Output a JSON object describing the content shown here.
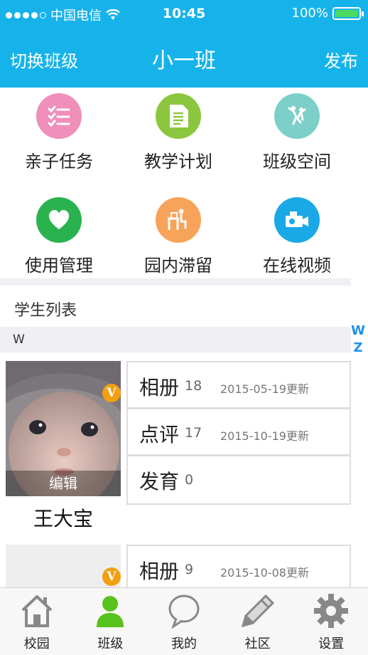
{
  "status": {
    "carrier": "中国电信",
    "time": "10:45",
    "battery": "100%"
  },
  "nav": {
    "left_label": "切换班级",
    "title": "小一班",
    "right_label": "发布"
  },
  "grid": [
    {
      "label": "亲子任务",
      "color": "#f08fb9",
      "icon": "checklist-icon"
    },
    {
      "label": "教学计划",
      "color": "#8cc63e",
      "icon": "document-icon"
    },
    {
      "label": "班级空间",
      "color": "#7dcfc9",
      "icon": "dancer-icon"
    },
    {
      "label": "使用管理",
      "color": "#2ab24f",
      "icon": "heart-icon"
    },
    {
      "label": "园内滞留",
      "color": "#f8a35a",
      "icon": "desk-icon"
    },
    {
      "label": "在线视频",
      "color": "#1aa9e6",
      "icon": "video-camera-icon"
    }
  ],
  "student_list": {
    "title": "学生列表",
    "group_letter": "W",
    "index_letters": [
      "W",
      "Z"
    ],
    "edit_label": "编辑",
    "badge_letter": "V",
    "students": [
      {
        "name": "王大宝",
        "stats": [
          {
            "key": "相册",
            "count": "18",
            "updated": "2015-05-19更新"
          },
          {
            "key": "点评",
            "count": "17",
            "updated": "2015-10-19更新"
          },
          {
            "key": "发育",
            "count": "0",
            "updated": ""
          }
        ]
      },
      {
        "name": "",
        "stats": [
          {
            "key": "相册",
            "count": "9",
            "updated": "2015-10-08更新"
          }
        ]
      }
    ]
  },
  "tabs": [
    {
      "label": "校园",
      "icon": "house-icon"
    },
    {
      "label": "班级",
      "icon": "person-icon",
      "active": true
    },
    {
      "label": "我的",
      "icon": "chat-bubble-icon"
    },
    {
      "label": "社区",
      "icon": "pencil-icon"
    },
    {
      "label": "设置",
      "icon": "gear-icon"
    }
  ],
  "colors": {
    "primary": "#15b3ea",
    "active_tab": "#58c21c",
    "badge": "#f2a010"
  }
}
